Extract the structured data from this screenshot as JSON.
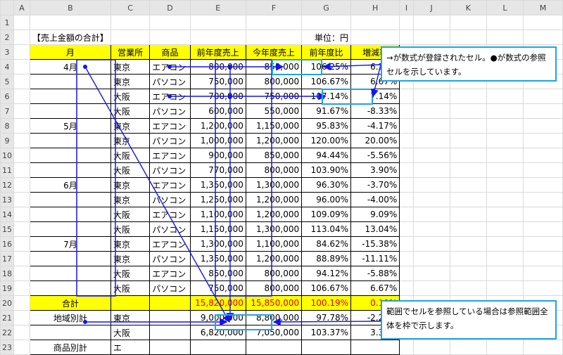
{
  "columns": [
    "A",
    "B",
    "C",
    "D",
    "E",
    "F",
    "G",
    "H",
    "I",
    "J",
    "K",
    "L",
    "M"
  ],
  "rows": [
    {
      "n": "1",
      "c": []
    },
    {
      "n": "2",
      "c": [
        "",
        "【売上金額の合計】",
        "",
        "",
        "",
        "",
        "単位：円",
        "",
        "",
        "",
        "",
        "",
        ""
      ]
    },
    {
      "n": "3",
      "c": [
        "",
        "月",
        "営業所",
        "商品",
        "前年度売上",
        "今年度売上",
        "前年度比",
        "増減率",
        "",
        "",
        "",
        "",
        ""
      ]
    },
    {
      "n": "4",
      "c": [
        "",
        "4月",
        "東京",
        "エアコン",
        "800,000",
        "850,000",
        "106.25%",
        "6.25%",
        "",
        "",
        "",
        "",
        ""
      ]
    },
    {
      "n": "5",
      "c": [
        "",
        "",
        "東京",
        "パソコン",
        "750,000",
        "800,000",
        "106.67%",
        "6.67%",
        "",
        "",
        "",
        "",
        ""
      ]
    },
    {
      "n": "6",
      "c": [
        "",
        "",
        "大阪",
        "エアコン",
        "700,000",
        "750,000",
        "107.14%",
        "7.14%",
        "",
        "",
        "",
        "",
        ""
      ]
    },
    {
      "n": "7",
      "c": [
        "",
        "",
        "大阪",
        "パソコン",
        "600,000",
        "550,000",
        "91.67%",
        "-8.33%",
        "",
        "",
        "",
        "",
        ""
      ]
    },
    {
      "n": "8",
      "c": [
        "",
        "5月",
        "東京",
        "エアコン",
        "1,200,000",
        "1,150,000",
        "95.83%",
        "-4.17%",
        "",
        "",
        "",
        "",
        ""
      ]
    },
    {
      "n": "9",
      "c": [
        "",
        "",
        "東京",
        "パソコン",
        "1,000,000",
        "1,200,000",
        "120.00%",
        "20.00%",
        "",
        "",
        "",
        "",
        ""
      ]
    },
    {
      "n": "10",
      "c": [
        "",
        "",
        "大阪",
        "エアコン",
        "900,000",
        "850,000",
        "94.44%",
        "-5.56%",
        "",
        "",
        "",
        "",
        ""
      ]
    },
    {
      "n": "11",
      "c": [
        "",
        "",
        "大阪",
        "パソコン",
        "770,000",
        "800,000",
        "103.90%",
        "3.90%",
        "",
        "",
        "",
        "",
        ""
      ]
    },
    {
      "n": "12",
      "c": [
        "",
        "6月",
        "東京",
        "エアコン",
        "1,350,000",
        "1,300,000",
        "96.30%",
        "-3.70%",
        "",
        "",
        "",
        "",
        ""
      ]
    },
    {
      "n": "13",
      "c": [
        "",
        "",
        "東京",
        "パソコン",
        "1,250,000",
        "1,200,000",
        "96.00%",
        "-4.00%",
        "",
        "",
        "",
        "",
        ""
      ]
    },
    {
      "n": "14",
      "c": [
        "",
        "",
        "大阪",
        "エアコン",
        "1,100,000",
        "1,200,000",
        "109.09%",
        "9.09%",
        "",
        "",
        "",
        "",
        ""
      ]
    },
    {
      "n": "15",
      "c": [
        "",
        "",
        "大阪",
        "パソコン",
        "1,150,000",
        "1,300,000",
        "113.04%",
        "13.04%",
        "",
        "",
        "",
        "",
        ""
      ]
    },
    {
      "n": "16",
      "c": [
        "",
        "7月",
        "東京",
        "エアコン",
        "1,300,000",
        "1,100,000",
        "84.62%",
        "-15.38%",
        "",
        "",
        "",
        "",
        ""
      ]
    },
    {
      "n": "17",
      "c": [
        "",
        "",
        "東京",
        "パソコン",
        "1,350,000",
        "1,200,000",
        "88.89%",
        "-11.11%",
        "",
        "",
        "",
        "",
        ""
      ]
    },
    {
      "n": "18",
      "c": [
        "",
        "",
        "大阪",
        "エアコン",
        "850,000",
        "800,000",
        "94.12%",
        "-5.88%",
        "",
        "",
        "",
        "",
        ""
      ]
    },
    {
      "n": "19",
      "c": [
        "",
        "",
        "大阪",
        "パソコン",
        "750,000",
        "800,000",
        "106.67%",
        "6.67%",
        "",
        "",
        "",
        "",
        ""
      ]
    },
    {
      "n": "20",
      "c": [
        "",
        "合計",
        "",
        "",
        "15,820,000",
        "15,850,000",
        "100.19%",
        "0.19%",
        "",
        "",
        "",
        "",
        ""
      ]
    },
    {
      "n": "21",
      "c": [
        "",
        "地域別計",
        "東京",
        "",
        "9,000,000",
        "8,800,000",
        "97.78%",
        "-2.22%",
        "",
        "",
        "",
        "",
        ""
      ]
    },
    {
      "n": "22",
      "c": [
        "",
        "",
        "大阪",
        "",
        "6,820,000",
        "7,050,000",
        "103.37%",
        "3.37%",
        "",
        "",
        "",
        "",
        ""
      ]
    },
    {
      "n": "23",
      "c": [
        "",
        "商品別計",
        "エ",
        "",
        "",
        "",
        "",
        "",
        "",
        "",
        "",
        "",
        ""
      ]
    }
  ],
  "annotations": {
    "note1": "→が数式が登録されたセル。●が数式の参照セルを示しています。",
    "note2": "範囲でセルを参照している場合は参照範囲全体を枠で示します。"
  },
  "colors": {
    "arrow": "#1414ee",
    "note_border": "#1ea5e0",
    "header_fill": "#ffff00",
    "total_text": "#e00000"
  }
}
